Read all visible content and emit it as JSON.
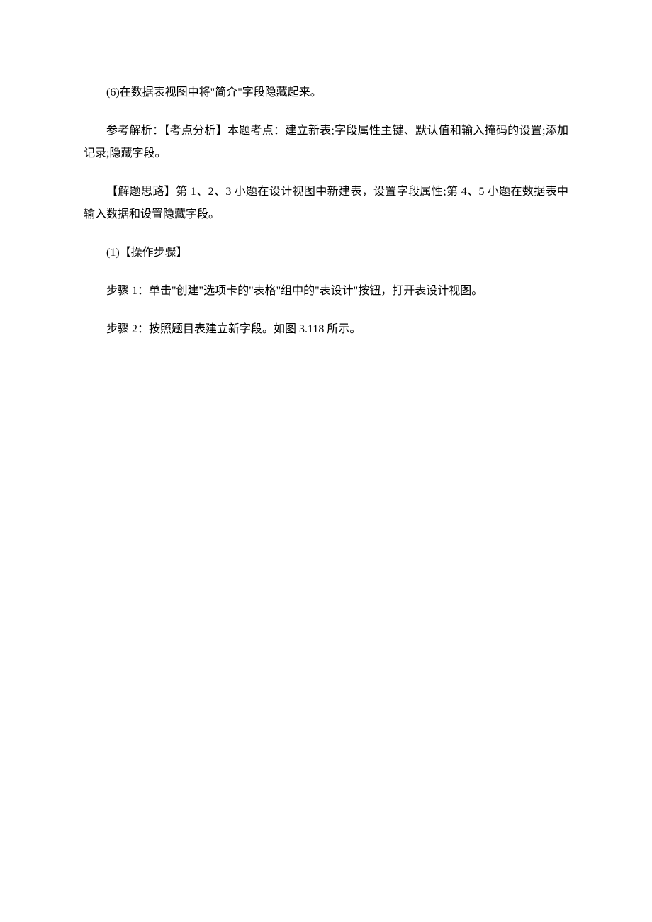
{
  "paragraphs": {
    "p1": "(6)在数据表视图中将\"简介\"字段隐藏起来。",
    "p2": "参考解析：【考点分析】本题考点：建立新表;字段属性主键、默认值和输入掩码的设置;添加记录;隐藏字段。",
    "p3": "【解题思路】第 1、2、3 小题在设计视图中新建表，设置字段属性;第 4、5 小题在数据表中输入数据和设置隐藏字段。",
    "p4": "(1)【操作步骤】",
    "p5": "步骤 1：单击\"创建\"选项卡的\"表格\"组中的\"表设计\"按钮，打开表设计视图。",
    "p6": "步骤 2：按照题目表建立新字段。如图 3.118 所示。"
  }
}
